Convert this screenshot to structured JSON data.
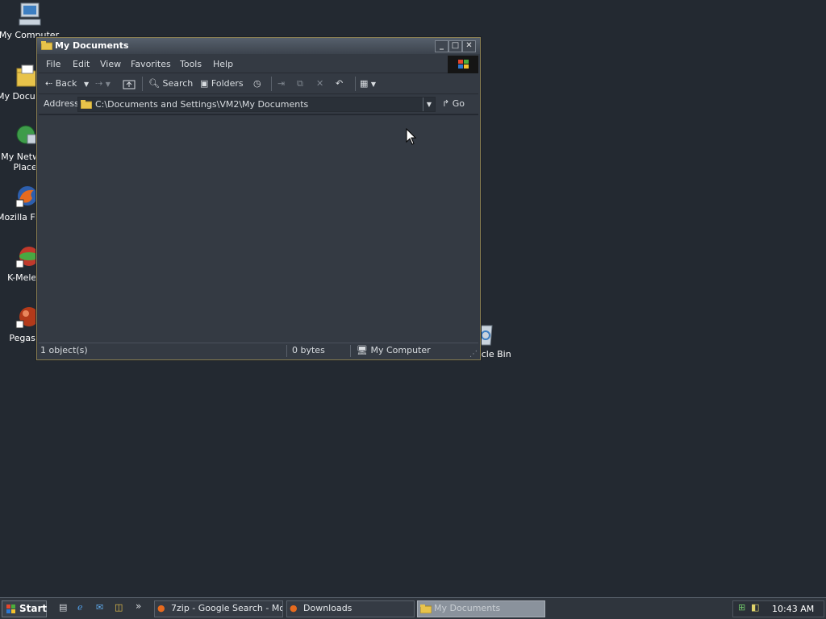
{
  "desktop": {
    "icons": [
      {
        "label": "My Computer",
        "icon": "my-computer-icon"
      },
      {
        "label": "My Documents",
        "icon": "my-documents-icon"
      },
      {
        "label": "My Network Places",
        "icon": "my-network-places-icon"
      },
      {
        "label": "Mozilla Firefox",
        "icon": "firefox-icon"
      },
      {
        "label": "K-Meleon",
        "icon": "k-meleon-icon"
      },
      {
        "label": "Pegasus",
        "icon": "pegasus-icon"
      },
      {
        "label": "Recycle Bin",
        "icon": "recycle-bin-icon"
      }
    ]
  },
  "window": {
    "title": "My Documents",
    "menu": [
      "File",
      "Edit",
      "View",
      "Favorites",
      "Tools",
      "Help"
    ],
    "toolbar": {
      "back_label": "Back",
      "search_label": "Search",
      "folders_label": "Folders"
    },
    "address": {
      "label": "Address",
      "value": "C:\\Documents and Settings\\VM2\\My Documents",
      "go_label": "Go"
    },
    "status": {
      "objects": "1 object(s)",
      "size": "0 bytes",
      "zone": "My Computer"
    }
  },
  "taskbar": {
    "start_label": "Start",
    "quicklaunch_chevron": "»",
    "tasks": [
      {
        "label": "7zip - Google Search - Mo...",
        "icon": "firefox-icon",
        "active": false
      },
      {
        "label": "Downloads",
        "icon": "firefox-icon",
        "active": false
      },
      {
        "label": "My Documents",
        "icon": "folder-icon",
        "active": true
      }
    ],
    "clock": "10:43 AM"
  },
  "colors": {
    "desktop": "#232931",
    "window_bg": "#343a43",
    "active_task": "#8a929c",
    "folder": "#e8c34a"
  }
}
